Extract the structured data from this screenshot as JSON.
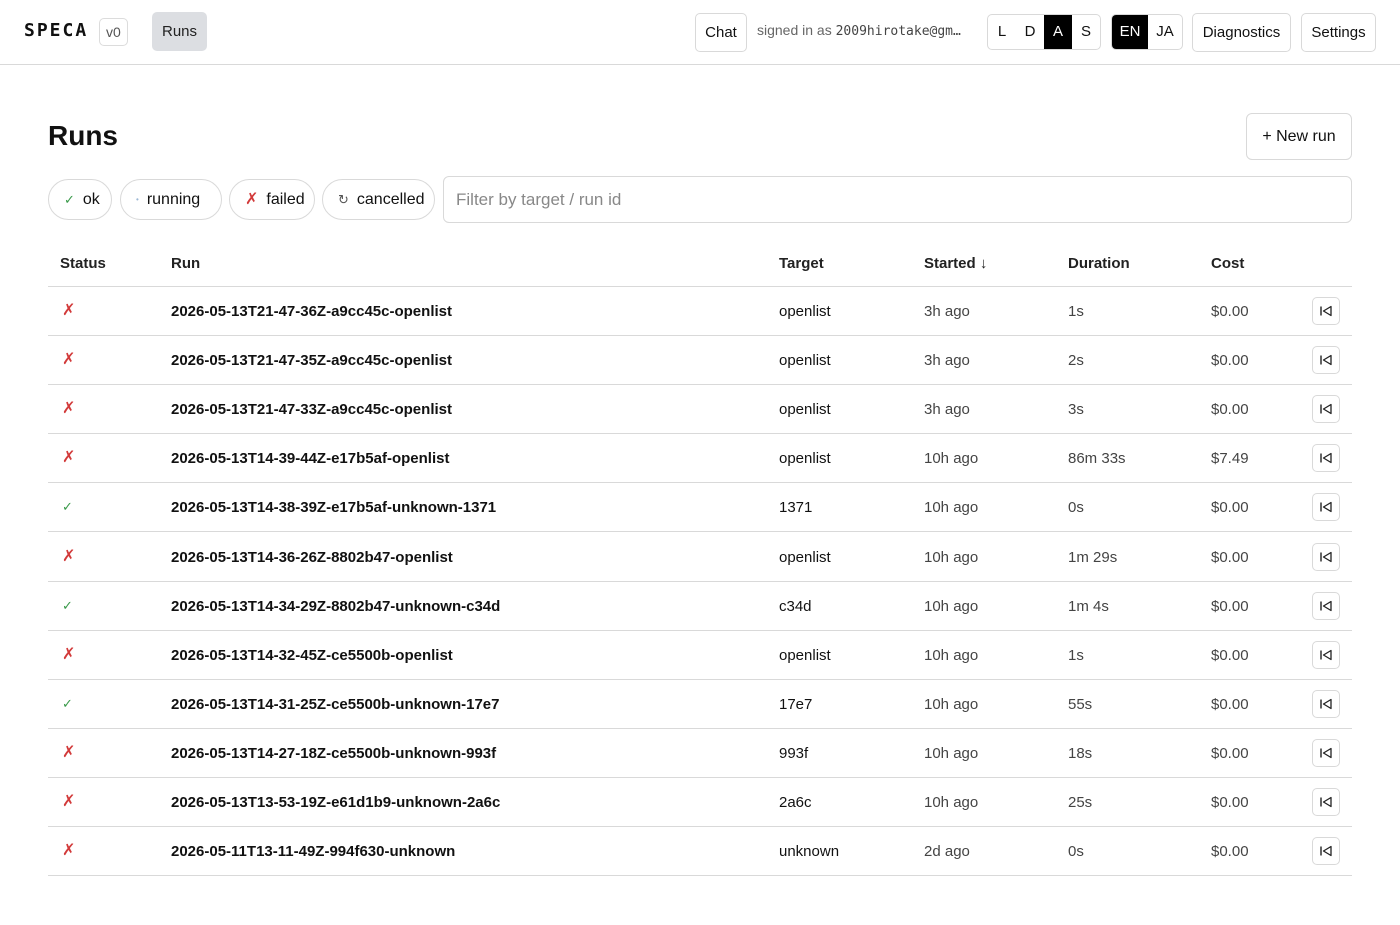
{
  "header": {
    "brand": "SPECA",
    "version": "v0",
    "nav_runs": "Runs",
    "chat": "Chat",
    "signed_in_prefix": "signed in as",
    "email": "2009hirotake@gm…",
    "theme_options": [
      "L",
      "D",
      "A",
      "S"
    ],
    "theme_selected": "A",
    "lang_options": [
      "EN",
      "JA"
    ],
    "lang_selected": "EN",
    "diagnostics": "Diagnostics",
    "settings": "Settings"
  },
  "main": {
    "title": "Runs",
    "new_run": "+ New run",
    "filters": [
      {
        "icon": "✓",
        "label": "ok"
      },
      {
        "icon": "•",
        "label": "running"
      },
      {
        "icon": "✗",
        "label": "failed"
      },
      {
        "icon": "↻",
        "label": "cancelled"
      }
    ],
    "filter_placeholder": "Filter by target / run id"
  },
  "table": {
    "headers": {
      "status": "Status",
      "run": "Run",
      "target": "Target",
      "started": "Started ↓",
      "duration": "Duration",
      "cost": "Cost"
    },
    "rows": [
      {
        "status": "failed",
        "status_icon": "✗",
        "run": "2026-05-13T21-47-36Z-a9cc45c-openlist",
        "target": "openlist",
        "started": "3h ago",
        "duration": "1s",
        "cost": "$0.00"
      },
      {
        "status": "failed",
        "status_icon": "✗",
        "run": "2026-05-13T21-47-35Z-a9cc45c-openlist",
        "target": "openlist",
        "started": "3h ago",
        "duration": "2s",
        "cost": "$0.00"
      },
      {
        "status": "failed",
        "status_icon": "✗",
        "run": "2026-05-13T21-47-33Z-a9cc45c-openlist",
        "target": "openlist",
        "started": "3h ago",
        "duration": "3s",
        "cost": "$0.00"
      },
      {
        "status": "failed",
        "status_icon": "✗",
        "run": "2026-05-13T14-39-44Z-e17b5af-openlist",
        "target": "openlist",
        "started": "10h ago",
        "duration": "86m 33s",
        "cost": "$7.49"
      },
      {
        "status": "ok",
        "status_icon": "✓",
        "run": "2026-05-13T14-38-39Z-e17b5af-unknown-1371",
        "target": "1371",
        "started": "10h ago",
        "duration": "0s",
        "cost": "$0.00"
      },
      {
        "status": "failed",
        "status_icon": "✗",
        "run": "2026-05-13T14-36-26Z-8802b47-openlist",
        "target": "openlist",
        "started": "10h ago",
        "duration": "1m 29s",
        "cost": "$0.00"
      },
      {
        "status": "ok",
        "status_icon": "✓",
        "run": "2026-05-13T14-34-29Z-8802b47-unknown-c34d",
        "target": "c34d",
        "started": "10h ago",
        "duration": "1m 4s",
        "cost": "$0.00"
      },
      {
        "status": "failed",
        "status_icon": "✗",
        "run": "2026-05-13T14-32-45Z-ce5500b-openlist",
        "target": "openlist",
        "started": "10h ago",
        "duration": "1s",
        "cost": "$0.00"
      },
      {
        "status": "ok",
        "status_icon": "✓",
        "run": "2026-05-13T14-31-25Z-ce5500b-unknown-17e7",
        "target": "17e7",
        "started": "10h ago",
        "duration": "55s",
        "cost": "$0.00"
      },
      {
        "status": "failed",
        "status_icon": "✗",
        "run": "2026-05-13T14-27-18Z-ce5500b-unknown-993f",
        "target": "993f",
        "started": "10h ago",
        "duration": "18s",
        "cost": "$0.00"
      },
      {
        "status": "failed",
        "status_icon": "✗",
        "run": "2026-05-13T13-53-19Z-e61d1b9-unknown-2a6c",
        "target": "2a6c",
        "started": "10h ago",
        "duration": "25s",
        "cost": "$0.00"
      },
      {
        "status": "failed",
        "status_icon": "✗",
        "run": "2026-05-11T13-11-49Z-994f630-unknown",
        "target": "unknown",
        "started": "2d ago",
        "duration": "0s",
        "cost": "$0.00"
      }
    ]
  },
  "colors": {
    "failed": "#d23a3a",
    "ok": "#3a9a4a",
    "running": "#9bb7d4",
    "selected": "#000000",
    "nav_active": "#dcdee2"
  }
}
